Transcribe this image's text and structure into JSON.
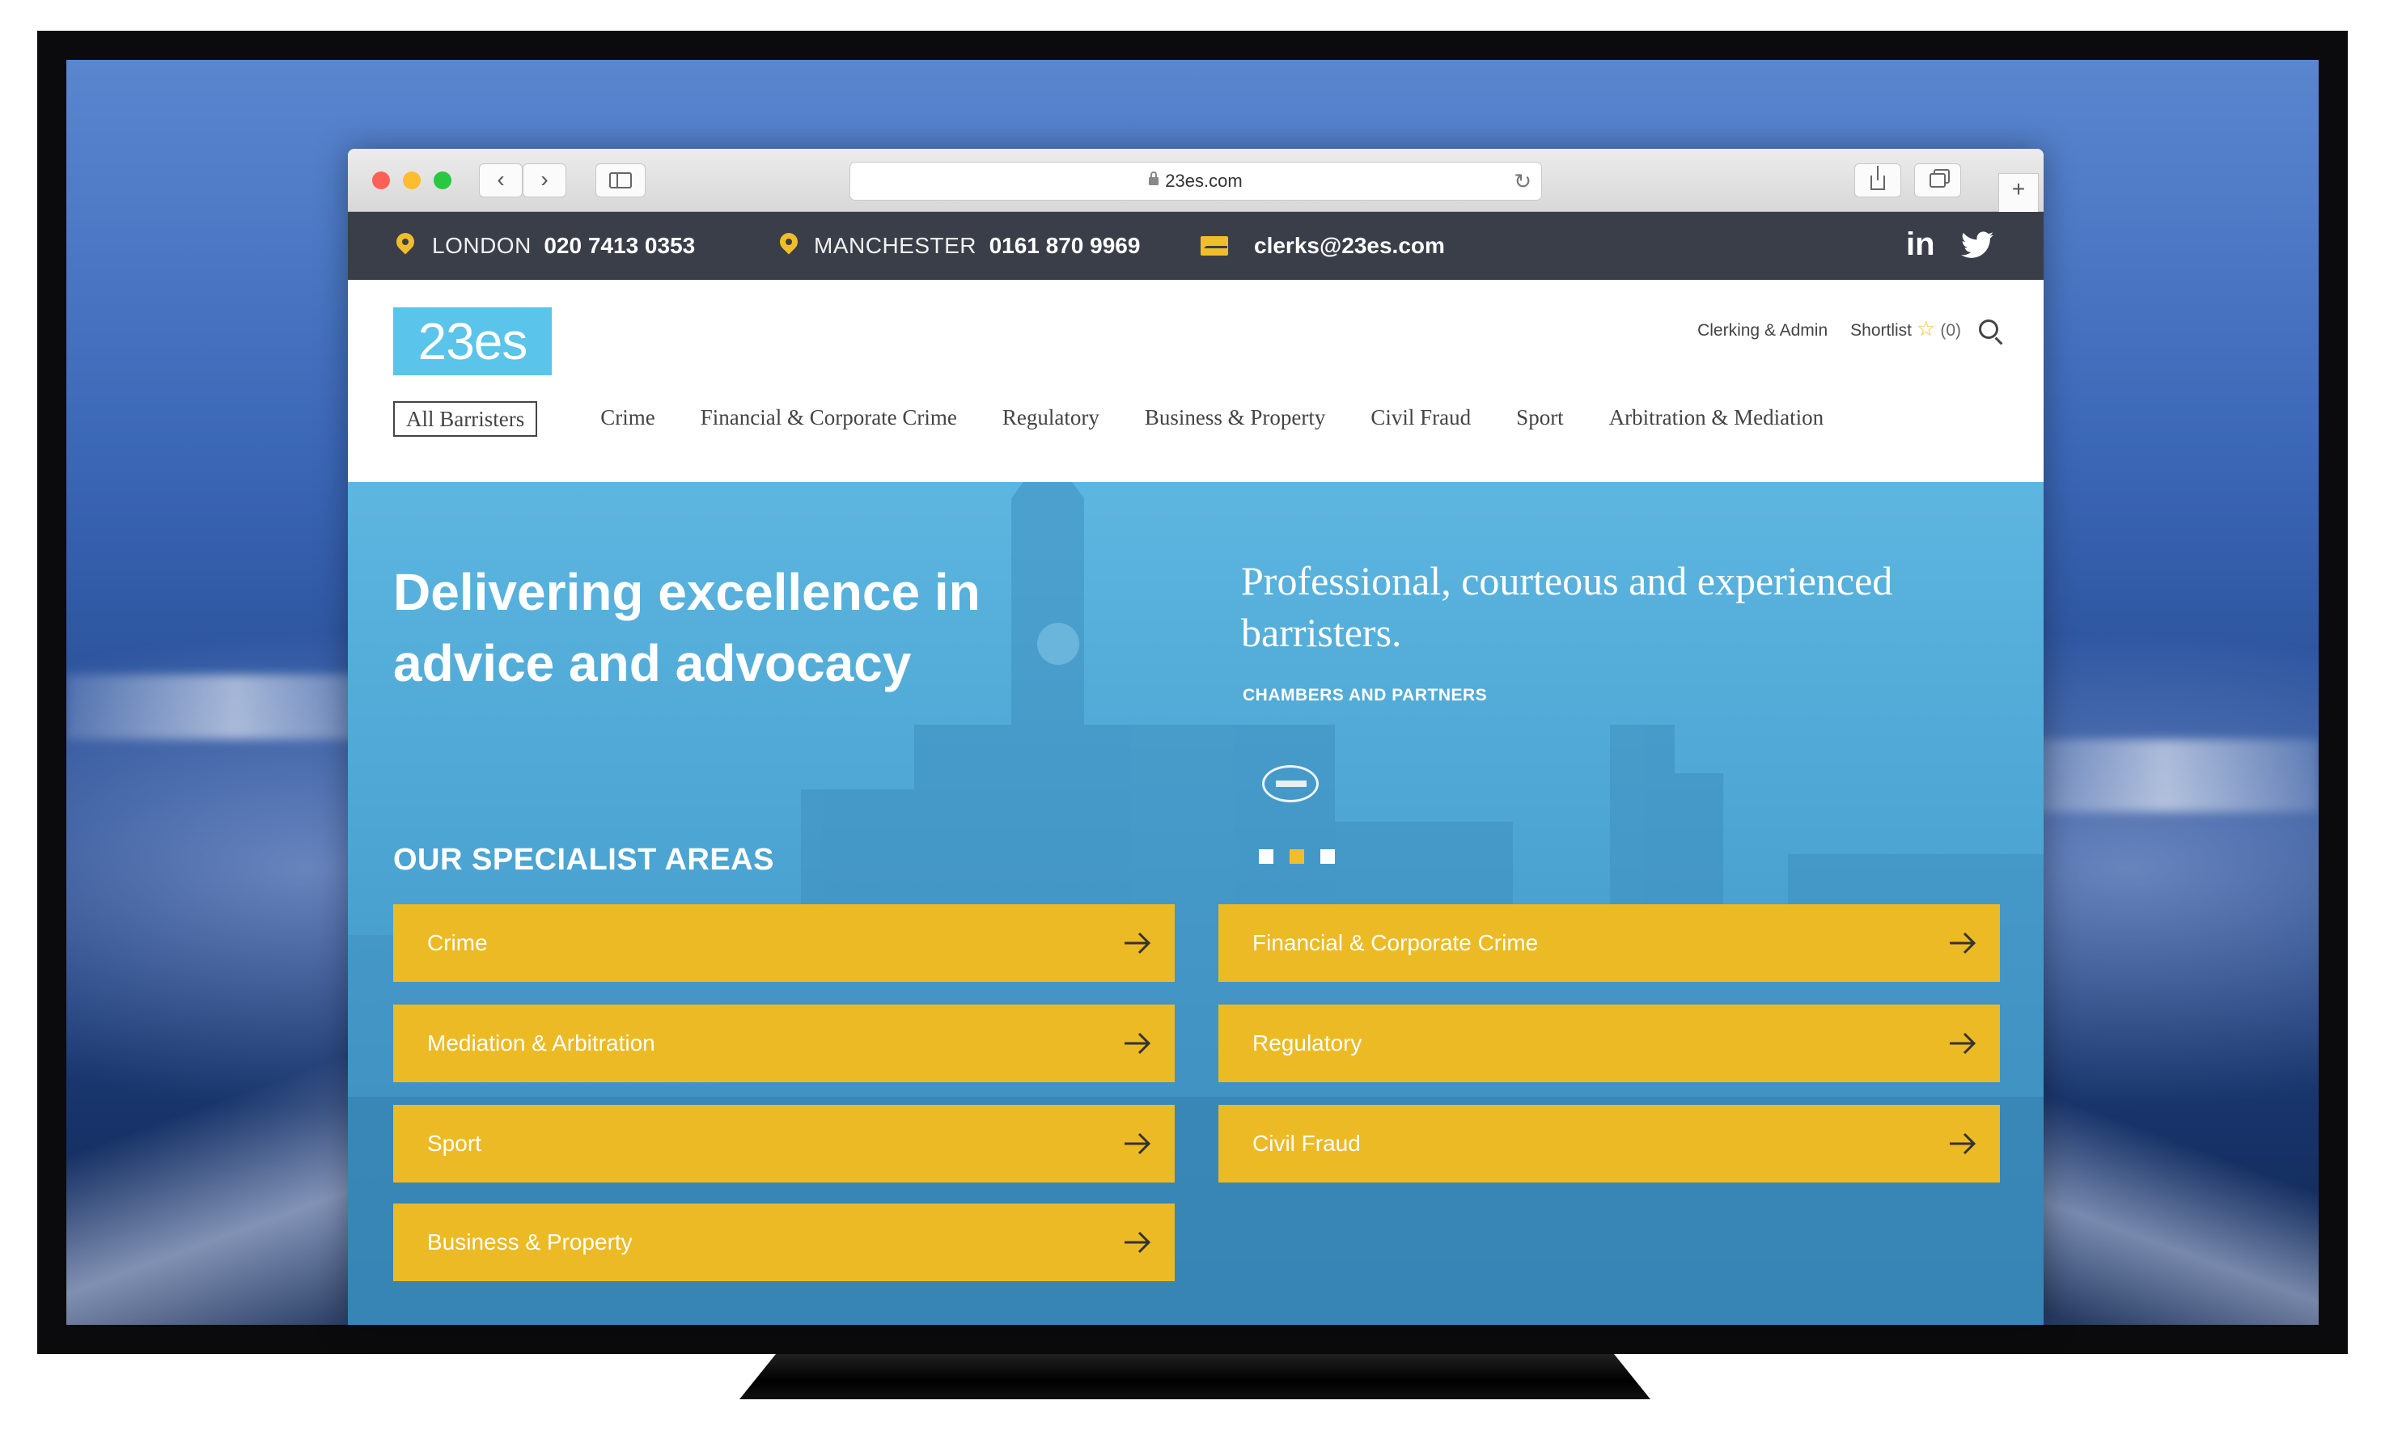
{
  "browser": {
    "url": "23es.com"
  },
  "topbar": {
    "london_city": "LONDON",
    "london_phone": "020 7413 0353",
    "manchester_city": "MANCHESTER",
    "manchester_phone": "0161 870 9969",
    "email": "clerks@23es.com",
    "linkedin_label": "in"
  },
  "header": {
    "logo_text": "23es",
    "clerking_link": "Clerking & Admin",
    "shortlist_link": "Shortlist",
    "shortlist_count": "(0)",
    "nav": [
      "All Barristers",
      "Crime",
      "Financial & Corporate Crime",
      "Regulatory",
      "Business & Property",
      "Civil Fraud",
      "Sport",
      "Arbitration & Mediation"
    ]
  },
  "hero": {
    "title": "Delivering excellence in advice and advocacy",
    "quote": "Professional, courteous and experienced barristers.",
    "quote_source": "CHAMBERS AND PARTNERS",
    "slider_active_index": 1,
    "slider_count": 3,
    "areas_heading": "OUR SPECIALIST AREAS",
    "areas": [
      "Crime",
      "Financial & Corporate Crime",
      "Mediation & Arbitration",
      "Regulatory",
      "Sport",
      "Civil Fraud",
      "Business & Property"
    ]
  },
  "colors": {
    "accent_yellow": "#ecba25",
    "topbar_dark": "#3a3e48",
    "logo_blue": "#5bc4ea",
    "hero_blue": "#4ba4d2"
  }
}
